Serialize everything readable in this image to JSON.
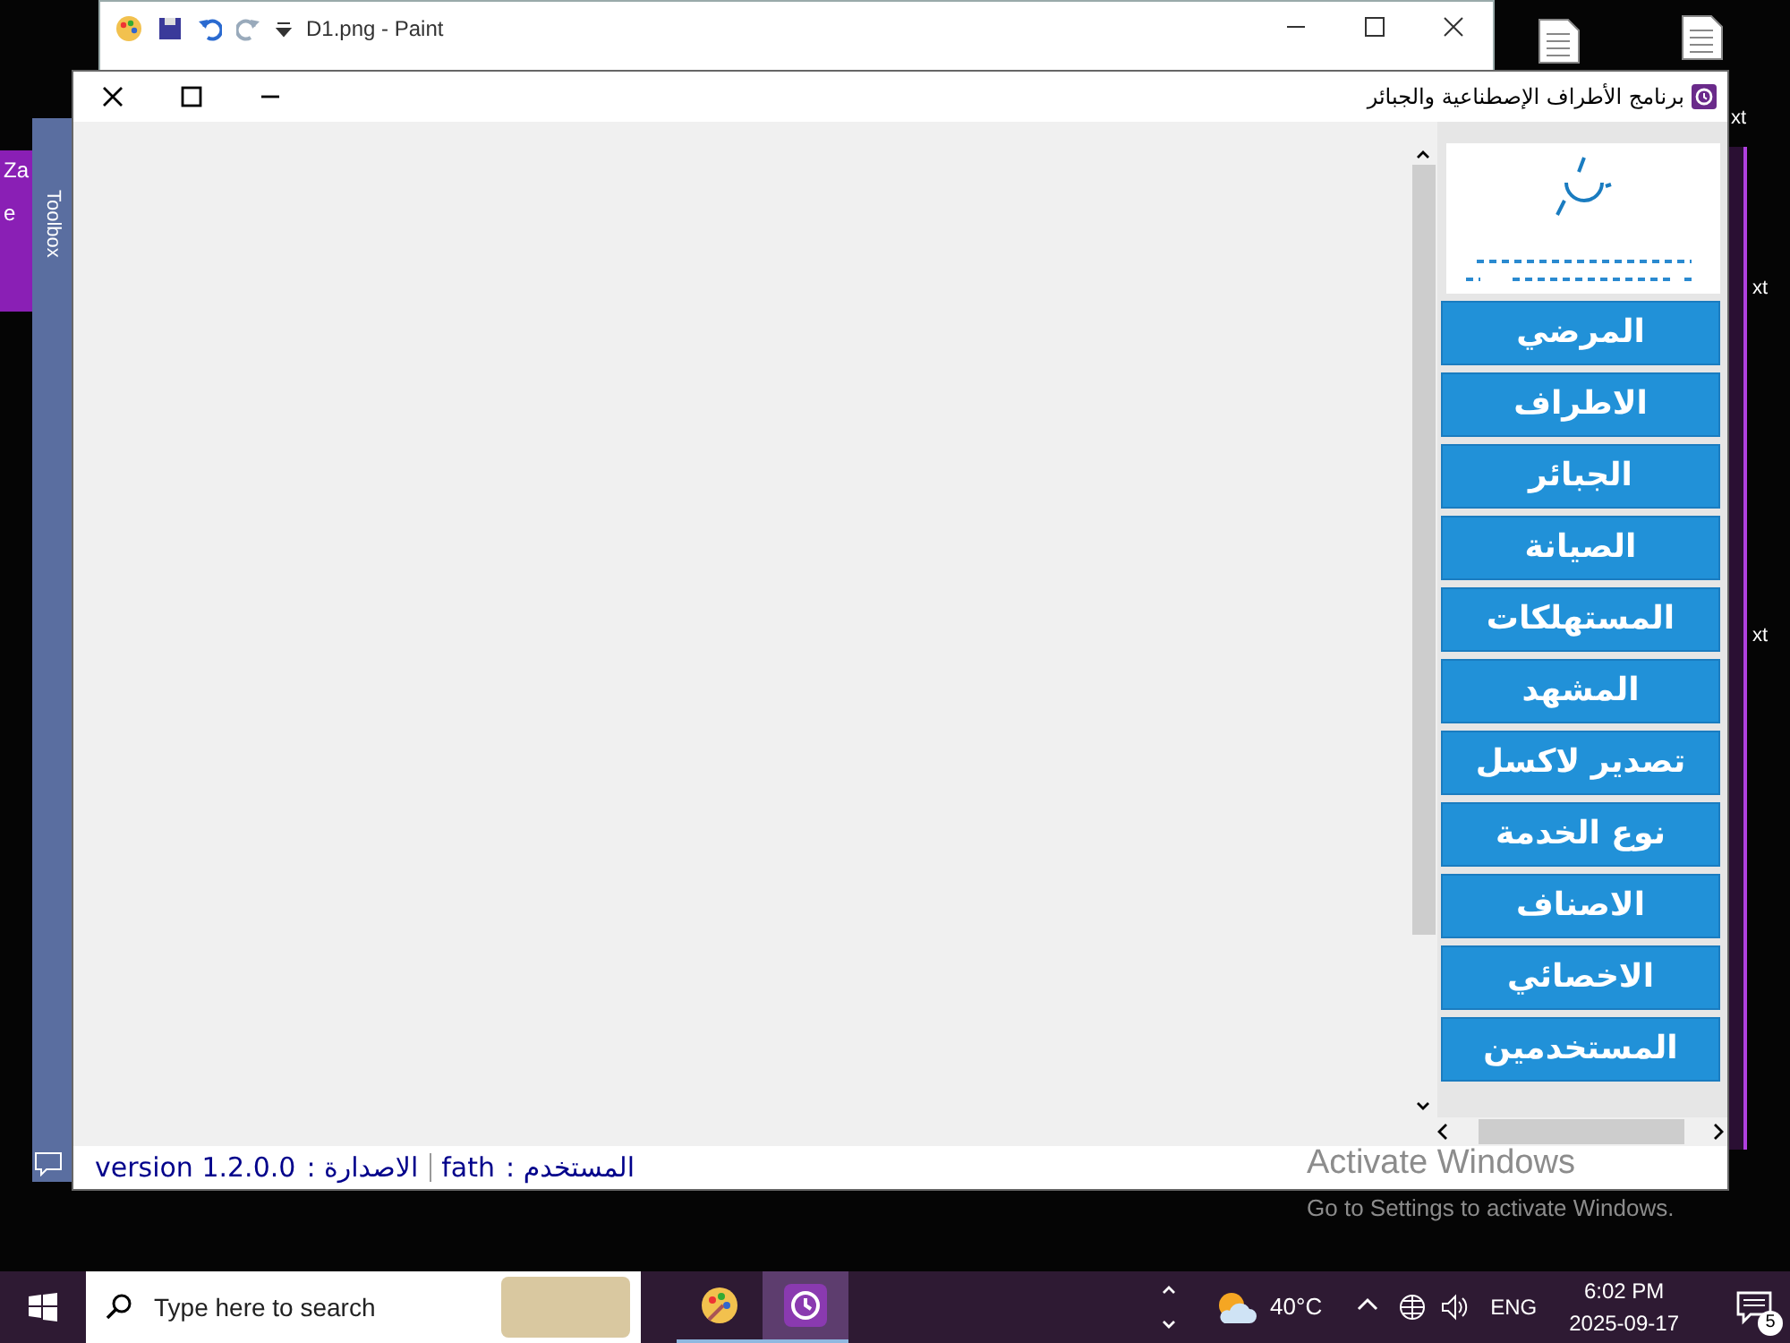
{
  "paint_window": {
    "title": "D1.png - Paint"
  },
  "left_window_fragment": {
    "lines": [
      "Za",
      "e"
    ]
  },
  "toolbox": {
    "label": "Toolbox"
  },
  "desktop_labels": [
    "xt",
    "xt",
    "xt"
  ],
  "app_window": {
    "title": "برنامج الأطراف الإصطناعية والجبائر",
    "nav_buttons": [
      "المرضي",
      "الاطراف",
      "الجبائر",
      "الصيانة",
      "المستهلكات",
      "المشهد",
      "تصدير لاكسل",
      "نوع الخدمة",
      "الاصناف",
      "الاخصائي",
      "المستخدمين"
    ],
    "status_bar": {
      "user_label": "المستخدم :",
      "user": "fath",
      "version_label": "الاصدارة :",
      "version": "version 1.2.0.0"
    }
  },
  "activation_notice": {
    "title": "Activate Windows",
    "text": "Go to Settings to activate Windows."
  },
  "taskbar": {
    "search": {
      "placeholder": "Type here to search"
    },
    "apps": [
      {
        "kind": "paint",
        "selected": false
      },
      {
        "kind": "history",
        "selected": true
      }
    ],
    "weather": "40°C",
    "language": "ENG",
    "time": "6:02 PM",
    "date": "2025-09-17",
    "notifications": "5"
  }
}
